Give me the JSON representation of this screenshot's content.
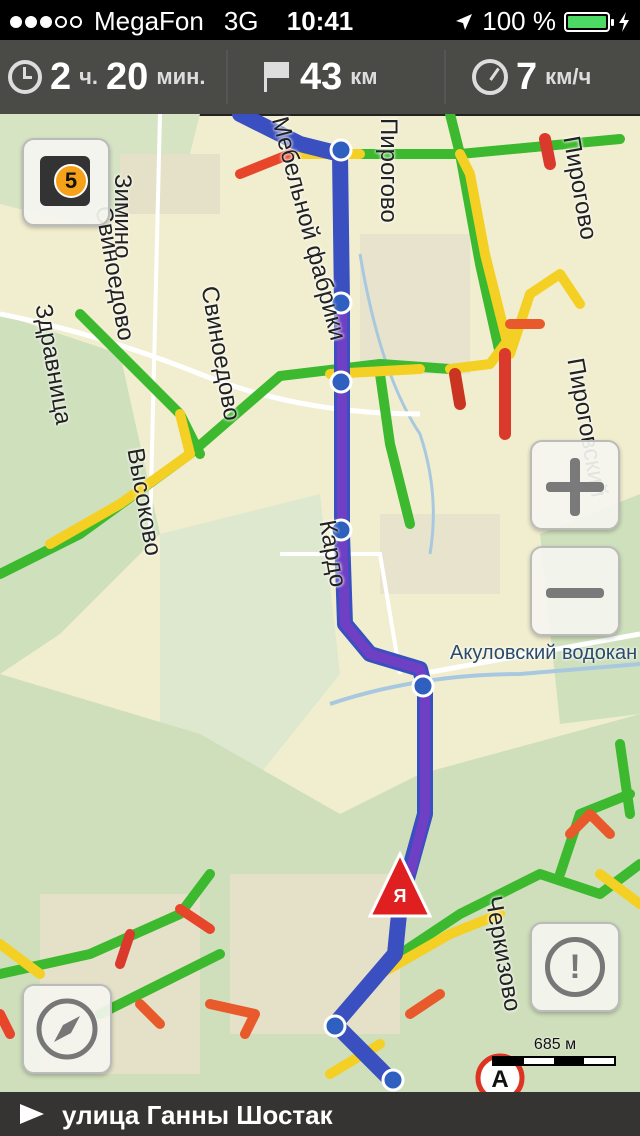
{
  "status": {
    "carrier": "MegaFon",
    "network": "3G",
    "time": "10:41",
    "battery": "100 %"
  },
  "info": {
    "time_hours": "2",
    "time_hours_unit": "ч.",
    "time_minutes": "20",
    "time_minutes_unit": "мин.",
    "distance": "43",
    "distance_unit": "км",
    "speed": "7",
    "speed_unit": "км/ч"
  },
  "map": {
    "labels": {
      "zimino": "Зимино",
      "svinoedovo1": "Свиноедово",
      "svinoedovo2": "Свиноедово",
      "zdravnitsa": "Здравница",
      "vysokovo": "Высоково",
      "mebelnoy": "Мебельной фабрики",
      "pirogovo1": "Пирогово",
      "pirogovo2": "Пирогово",
      "pirogovsky": "Пироговский",
      "akulovsky": "Акуловский водокан",
      "karda": "Кардо",
      "cherkizovo": "Черкизово"
    },
    "traffic_level": "5",
    "marker_a": "A",
    "marker_ya": "Я",
    "scale_label": "685 м"
  },
  "bottom": {
    "street": "улица Ганны Шостак"
  }
}
